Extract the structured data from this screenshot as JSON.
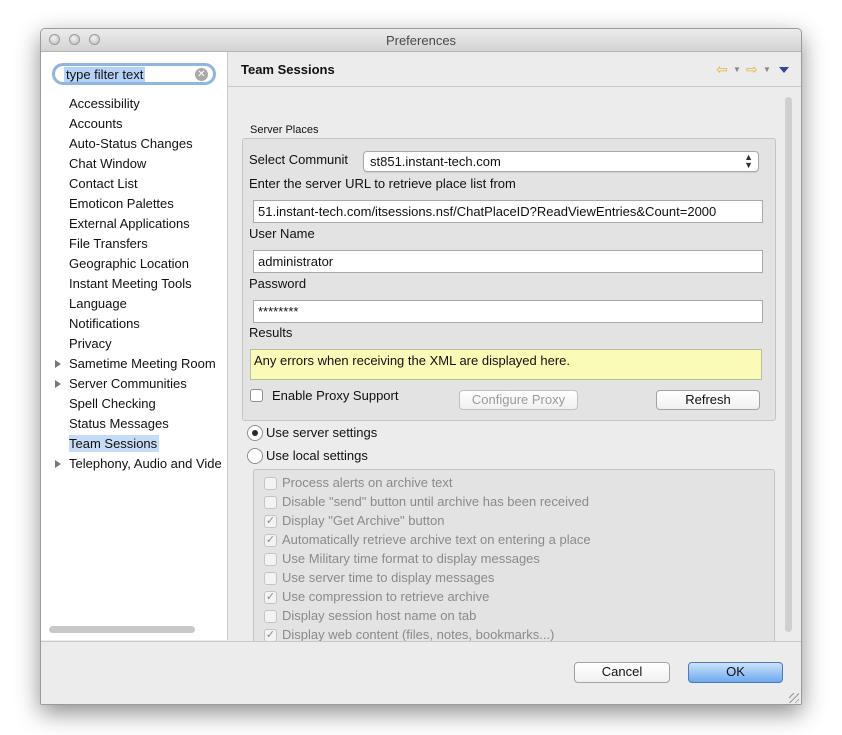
{
  "window": {
    "title": "Preferences"
  },
  "sidebar": {
    "filter_value": "type filter text",
    "items": [
      {
        "label": "Accessibility",
        "expandable": false,
        "selected": false
      },
      {
        "label": "Accounts",
        "expandable": false,
        "selected": false
      },
      {
        "label": "Auto-Status Changes",
        "expandable": false,
        "selected": false
      },
      {
        "label": "Chat Window",
        "expandable": false,
        "selected": false
      },
      {
        "label": "Contact List",
        "expandable": false,
        "selected": false
      },
      {
        "label": "Emoticon Palettes",
        "expandable": false,
        "selected": false
      },
      {
        "label": "External Applications",
        "expandable": false,
        "selected": false
      },
      {
        "label": "File Transfers",
        "expandable": false,
        "selected": false
      },
      {
        "label": "Geographic Location",
        "expandable": false,
        "selected": false
      },
      {
        "label": "Instant Meeting Tools",
        "expandable": false,
        "selected": false
      },
      {
        "label": "Language",
        "expandable": false,
        "selected": false
      },
      {
        "label": "Notifications",
        "expandable": false,
        "selected": false
      },
      {
        "label": "Privacy",
        "expandable": false,
        "selected": false
      },
      {
        "label": "Sametime Meeting Room",
        "expandable": true,
        "selected": false
      },
      {
        "label": "Server Communities",
        "expandable": true,
        "selected": false
      },
      {
        "label": "Spell Checking",
        "expandable": false,
        "selected": false
      },
      {
        "label": "Status Messages",
        "expandable": false,
        "selected": false
      },
      {
        "label": "Team Sessions",
        "expandable": false,
        "selected": true
      },
      {
        "label": "Telephony, Audio and Video",
        "expandable": true,
        "selected": false
      }
    ]
  },
  "page": {
    "title": "Team Sessions",
    "server_places": {
      "group_label": "Server Places",
      "community_label": "Select Communit",
      "community_value": "st851.instant-tech.com",
      "url_label": "Enter the server URL to retrieve place list from",
      "url_value": "51.instant-tech.com/itsessions.nsf/ChatPlaceID?ReadViewEntries&Count=2000",
      "username_label": "User Name",
      "username_value": "administrator",
      "password_label": "Password",
      "password_value": "********",
      "results_label": "Results",
      "results_text": "Any errors when receiving the XML are displayed here.",
      "proxy_label": "Enable Proxy Support",
      "proxy_checked": false,
      "configure_proxy_label": "Configure Proxy",
      "refresh_label": "Refresh"
    },
    "settings_mode": {
      "use_server_label": "Use server settings",
      "use_local_label": "Use local settings",
      "selected": "server"
    },
    "local_options": [
      {
        "label": "Process alerts on archive text",
        "checked": false
      },
      {
        "label": "Disable \"send\" button until archive has been received",
        "checked": false
      },
      {
        "label": "Display \"Get Archive\" button",
        "checked": true
      },
      {
        "label": "Automatically retrieve archive text on entering a place",
        "checked": true
      },
      {
        "label": "Use Military time format to display messages",
        "checked": false
      },
      {
        "label": "Use server time to display messages",
        "checked": false
      },
      {
        "label": "Use compression to retrieve archive",
        "checked": true
      },
      {
        "label": "Display session host name on tab",
        "checked": false
      },
      {
        "label": "Display web content (files, notes, bookmarks...)",
        "checked": true
      }
    ]
  },
  "footer": {
    "cancel_label": "Cancel",
    "ok_label": "OK"
  },
  "icons": {
    "back": "back-arrow-icon",
    "forward": "forward-arrow-icon",
    "menu": "view-menu-icon",
    "clear": "clear-search-icon",
    "check": "✓"
  },
  "colors": {
    "selection": "#c6dcf6",
    "results_bg": "#fbfbb8",
    "ok_button": "#6ea9ef",
    "nav_arrow": "#e4b33e"
  }
}
